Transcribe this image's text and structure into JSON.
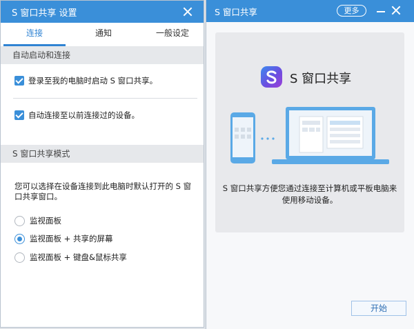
{
  "settings_window": {
    "title": "S 窗口共享 设置",
    "tabs": [
      {
        "label": "连接",
        "active": true
      },
      {
        "label": "通知",
        "active": false
      },
      {
        "label": "一般设定",
        "active": false
      }
    ],
    "section_autostart": {
      "header": "自动启动和连接",
      "options": [
        {
          "label": "登录至我的电脑时启动 S 窗口共享。",
          "checked": true
        },
        {
          "label": "自动连接至以前连接过的设备。",
          "checked": true
        }
      ]
    },
    "section_mode": {
      "header": "S 窗口共享模式",
      "description": "您可以选择在设备连接到此电脑时默认打开的 S 窗口共享窗口。",
      "options": [
        {
          "label": "监视面板",
          "selected": false
        },
        {
          "label": "监视面板 + 共享的屏幕",
          "selected": true
        },
        {
          "label": "监视面板 + 键盘&鼠标共享",
          "selected": false
        }
      ]
    }
  },
  "main_window": {
    "title": "S 窗口共享",
    "more_label": "更多",
    "brand_name": "S 窗口共享",
    "caption": "S 窗口共享方便您通过连接至计算机或平板电脑来使用移动设备。",
    "start_label": "开始"
  },
  "icons": {
    "close": "close-icon",
    "minimize": "minimize-icon",
    "logo": "s-window-share-logo-icon",
    "illustration": "phone-to-laptop-illustration"
  },
  "colors": {
    "accent": "#3a8fd9",
    "titlebar": "#3a8fd9",
    "section_bg": "#e6e8eb",
    "card_bg": "#e8e9ec",
    "illustration_blue": "#5aa9e6"
  }
}
